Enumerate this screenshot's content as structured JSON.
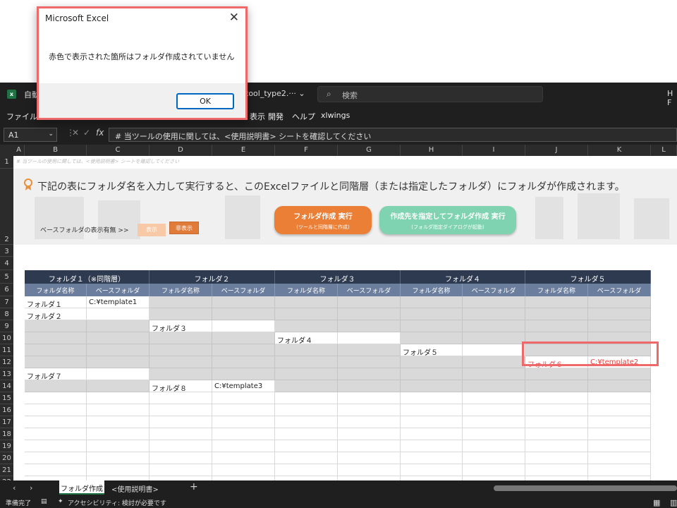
{
  "dialog": {
    "title": "Microsoft Excel",
    "close_glyph": "✕",
    "message": "赤色で表示された箇所はフォルダ作成されていません",
    "ok_label": "OK"
  },
  "titlebar": {
    "icon": "excel-icon",
    "app_prefix": "自動",
    "filename": "tool_type2.··· ⌄",
    "search_placeholder": "検索",
    "user_initials": "H F"
  },
  "menu": {
    "items": [
      "ファイル",
      "表示",
      "開発",
      "ヘルプ",
      "xlwings"
    ]
  },
  "formula_bar": {
    "name_box": "A1",
    "fx_label": "fx",
    "content": "# 当ツールの使用に関しては、<使用説明書> シートを確認してください"
  },
  "columns": [
    "A",
    "B",
    "C",
    "D",
    "E",
    "F",
    "G",
    "H",
    "I",
    "J",
    "K",
    "L"
  ],
  "rows": [
    "1",
    "2",
    "3",
    "4",
    "5",
    "6",
    "7",
    "8",
    "9",
    "10",
    "11",
    "12",
    "13",
    "14",
    "15",
    "16",
    "17",
    "18",
    "19",
    "20",
    "21",
    "22"
  ],
  "sheet": {
    "row1_note": "# 当ツールの使用に関しては、<使用説明書> シートを確認してください",
    "headline": "下記の表にフォルダ名を入力して実行すると、このExcelファイルと同階層（または指定したフォルダ）にフォルダが作成されます。",
    "basefolder_label": "ベースフォルダの表示有無 >>",
    "show_button": "表示",
    "hide_button": "非表示",
    "run_button": {
      "line1": "フォルダ作成 実行",
      "line2": "(ツールと同階層に作成)"
    },
    "run_dest_button": {
      "line1": "作成先を指定してフォルダ作成 実行",
      "line2": "(フォルダ指定ダイアログが起動)"
    },
    "table": {
      "groups": [
        "フォルダ１（※同階層）",
        "フォルダ２",
        "フォルダ３",
        "フォルダ４",
        "フォルダ５"
      ],
      "sub_name": "フォルダ名称",
      "sub_base": "ベースフォルダ",
      "entries": [
        {
          "name": "フォルダ１",
          "base": "C:¥template1",
          "level": 1,
          "row": 7,
          "error": false
        },
        {
          "name": "フォルダ２",
          "base": "",
          "level": 1,
          "row": 8,
          "error": false
        },
        {
          "name": "フォルダ３",
          "base": "",
          "level": 2,
          "row": 9,
          "error": false
        },
        {
          "name": "フォルダ４",
          "base": "",
          "level": 3,
          "row": 10,
          "error": false
        },
        {
          "name": "フォルダ５",
          "base": "",
          "level": 4,
          "row": 11,
          "error": false
        },
        {
          "name": "フォルダ６",
          "base": "C:¥template2",
          "level": 5,
          "row": 12,
          "error": true
        },
        {
          "name": "フォルダ７",
          "base": "",
          "level": 1,
          "row": 13,
          "error": false
        },
        {
          "name": "フォルダ８",
          "base": "C:¥template3",
          "level": 2,
          "row": 14,
          "error": false
        }
      ]
    }
  },
  "tabs": {
    "active": "フォルダ作成",
    "other": "<使用説明書>",
    "add": "+"
  },
  "status": {
    "ready": "準備完了",
    "accessibility": "アクセシビリティ: 検討が必要です"
  }
}
